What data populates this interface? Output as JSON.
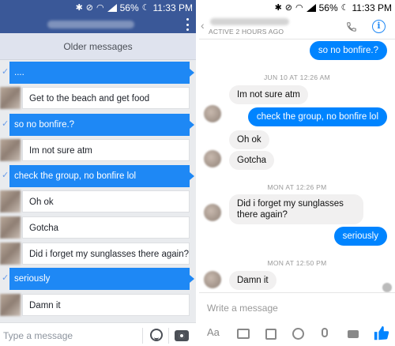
{
  "status_bar": {
    "battery": "56%",
    "time": "11:33 PM"
  },
  "left": {
    "older_messages": "Older messages",
    "messages": [
      {
        "direction": "out",
        "text": "...."
      },
      {
        "direction": "in",
        "text": "Get to the beach and get food"
      },
      {
        "direction": "out",
        "text": "so no bonfire.?"
      },
      {
        "direction": "in",
        "text": "Im not sure atm"
      },
      {
        "direction": "out",
        "text": "check the group, no bonfire lol"
      },
      {
        "direction": "in",
        "text": "Oh ok"
      },
      {
        "direction": "in",
        "text": "Gotcha"
      },
      {
        "direction": "in",
        "text": "Did i forget my sunglasses there again?"
      },
      {
        "direction": "out",
        "text": "seriously"
      },
      {
        "direction": "in",
        "text": "Damn it"
      }
    ],
    "input_placeholder": "Type a message"
  },
  "right": {
    "active_status": "ACTIVE 2 HOURS AGO",
    "timestamps": [
      "JUN 10 AT 12:26 AM",
      "MON AT 12:26 PM",
      "MON AT 12:50 PM"
    ],
    "messages": {
      "m1": "so no bonfire.?",
      "m2": "Im not sure atm",
      "m3": "check the group, no bonfire lol",
      "m4": "Oh ok",
      "m5": "Gotcha",
      "m6": "Did i forget my sunglasses there again?",
      "m7": "seriously",
      "m8": "Damn it"
    },
    "input_placeholder": "Write a message",
    "tools": {
      "text_format": "Aa"
    }
  },
  "colors": {
    "facebook_blue": "#3a5898",
    "sent_bubble": "#1e88f5",
    "messenger_blue": "#0084ff"
  },
  "icons": [
    "bluetooth-icon",
    "silent-icon",
    "wifi-icon",
    "signal-icon",
    "battery-icon",
    "moon-icon",
    "menu-icon",
    "camera-icon",
    "emoji-icon",
    "phone-icon",
    "info-icon",
    "image-icon",
    "mic-icon",
    "more-icon",
    "thumbs-up-icon"
  ]
}
